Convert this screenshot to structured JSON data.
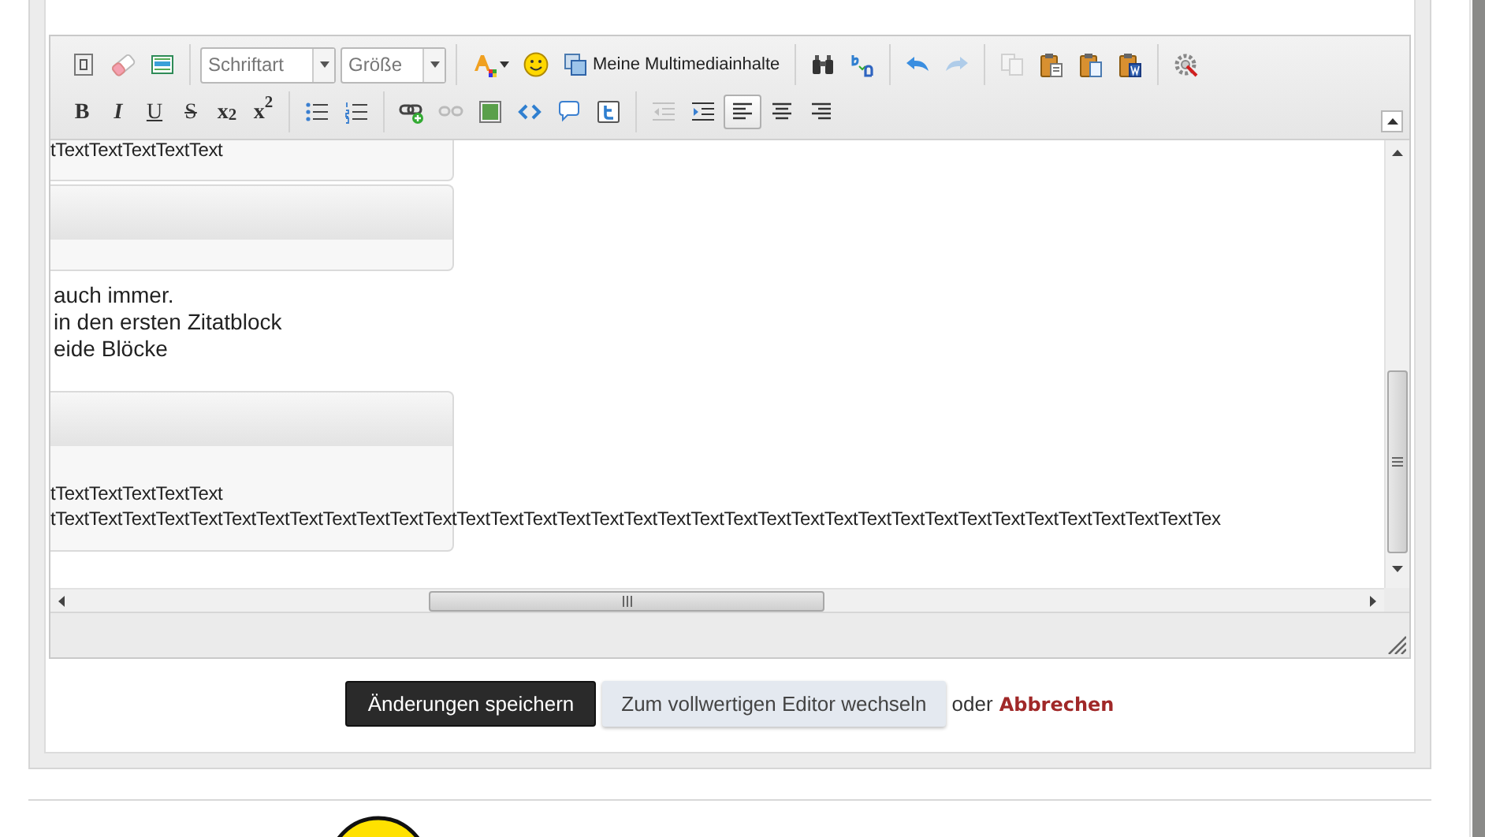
{
  "toolbar": {
    "rows": [
      [
        [
          {
            "kind": "icon",
            "disabled": false,
            "selected": false
          },
          {
            "kind": "icon",
            "disabled": false,
            "selected": false
          },
          {
            "kind": "icon",
            "disabled": false,
            "selected": false
          }
        ],
        [
          {
            "kind": "dropdown",
            "placeholder": "Schriftart"
          },
          {
            "kind": "dropdown",
            "placeholder": "Größe"
          }
        ],
        [
          {
            "kind": "icon_caret",
            "disabled": false,
            "selected": false
          },
          {
            "kind": "icon",
            "disabled": false,
            "selected": false
          },
          {
            "kind": "icon_label",
            "label": "Meine Multimediainhalte",
            "disabled": false,
            "selected": false
          }
        ],
        [
          {
            "kind": "icon",
            "disabled": false,
            "selected": false
          },
          {
            "kind": "icon",
            "disabled": false,
            "selected": false
          }
        ],
        [
          {
            "kind": "icon",
            "disabled": false,
            "selected": false
          },
          {
            "kind": "icon",
            "disabled": true,
            "selected": false
          }
        ],
        [
          {
            "kind": "icon",
            "disabled": true,
            "selected": false
          },
          {
            "kind": "icon",
            "disabled": false,
            "selected": false
          },
          {
            "kind": "icon",
            "disabled": false,
            "selected": false
          },
          {
            "kind": "icon",
            "disabled": false,
            "selected": false
          }
        ],
        [
          {
            "kind": "icon",
            "disabled": false,
            "selected": false
          }
        ]
      ],
      [
        [
          {
            "kind": "text",
            "label": "B",
            "disabled": false,
            "selected": false
          },
          {
            "kind": "text",
            "label": "I",
            "disabled": false,
            "selected": false
          },
          {
            "kind": "text",
            "label": "U",
            "disabled": false,
            "selected": false
          },
          {
            "kind": "text",
            "label": "S",
            "disabled": false,
            "selected": false
          },
          {
            "kind": "text",
            "label": "x$_{2}$",
            "disabled": false,
            "selected": false
          },
          {
            "kind": "text",
            "label": "x$^{2}$",
            "disabled": false,
            "selected": false
          }
        ],
        [
          {
            "kind": "icon",
            "disabled": false,
            "selected": false
          },
          {
            "kind": "icon",
            "disabled": false,
            "selected": false
          }
        ],
        [
          {
            "kind": "icon",
            "disabled": false,
            "selected": false
          },
          {
            "kind": "icon",
            "disabled": true,
            "selected": false
          },
          {
            "kind": "icon",
            "disabled": false,
            "selected": false
          },
          {
            "kind": "icon",
            "disabled": false,
            "selected": false
          },
          {
            "kind": "icon",
            "disabled": false,
            "selected": false
          },
          {
            "kind": "icon",
            "disabled": false,
            "selected": false
          }
        ],
        [
          {
            "kind": "icon",
            "disabled": true,
            "selected": false
          },
          {
            "kind": "icon",
            "disabled": false,
            "selected": false
          },
          {
            "kind": "icon",
            "disabled": false,
            "selected": true
          },
          {
            "kind": "icon",
            "disabled": false,
            "selected": false
          },
          {
            "kind": "icon",
            "disabled": false,
            "selected": false
          }
        ]
      ]
    ]
  },
  "document": [
    {
      "kind": "quote_block",
      "header_shown": false,
      "lines": [
        "tTextTextTextTextText"
      ]
    },
    {
      "kind": "quote_block",
      "header_shown": true
    },
    {
      "kind": "paragraph",
      "lines": [
        "auch immer.",
        "in den ersten Zitatblock",
        "eide Blöcke"
      ]
    },
    {
      "kind": "quote_block",
      "header_shown": true,
      "lines": [
        "tTextTextTextTextText",
        "tTextTextTextTextTextTextTextTextTextTextTextTextTextTextTextTextTextTextTextTextTextTextTextTextTextTextTextTextTextTextTextTextTextTextTex"
      ]
    }
  ],
  "actions": {
    "save": "Änderungen speichern",
    "switch_editor": "Zum vollwertigen Editor wechseln",
    "or": "oder",
    "cancel": "Abbrechen"
  }
}
